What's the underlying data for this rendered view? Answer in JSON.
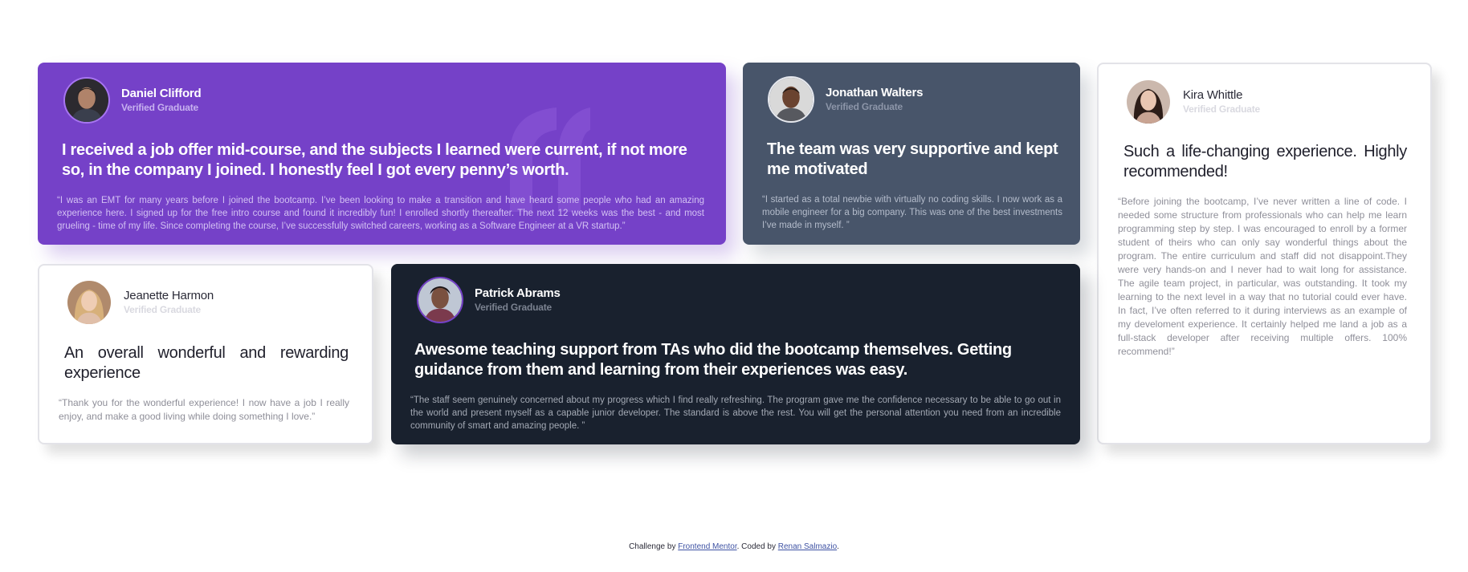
{
  "testimonials": [
    {
      "name": "Daniel Clifford",
      "status": "Verified Graduate",
      "headline": "I received a job offer mid-course, and the subjects I learned were current, if not more so, in the company I joined. I honestly feel I got every penny’s worth.",
      "body": "“I was an EMT for many years before I joined the bootcamp. I’ve been looking to make a transition and have heard some people who had an amazing experience here. I signed up for the free intro course and found it incredibly fun! I enrolled shortly thereafter. The next 12 weeks was the best - and most grueling - time of my life. Since completing the course, I’ve successfully switched careers, working as a Software Engineer at a VR startup.”",
      "background": "#7541c8"
    },
    {
      "name": "Jonathan Walters",
      "status": "Verified Graduate",
      "headline": "The team was very supportive and kept me motivated",
      "body": "“I started as a total newbie with virtually no coding skills. I now work as a mobile engineer for a big company. This was one of the best investments I’ve made in myself. ”",
      "background": "#48556a"
    },
    {
      "name": "Kira Whittle",
      "status": "Verified Graduate",
      "headline": "Such a life-changing experience. Highly recommended!",
      "body": "“Before joining the bootcamp, I’ve never written a line of code. I needed some structure from professionals who can help me learn programming step by step. I was encouraged to enroll by a former student of theirs who can only say wonderful things about the program. The entire curriculum and staff did not disappoint.They were very hands-on and I never had to wait long for assistance. The agile team project, in particular, was outstanding. It took my learning to the next level in a way that no tutorial could ever have. In fact, I’ve often referred to it during interviews as an example of my develoment experience. It certainly helped me land a job as a full-stack developer after receiving multiple offers. 100% recommend!”",
      "background": "#ffffff"
    },
    {
      "name": "Jeanette Harmon",
      "status": "Verified Graduate",
      "headline": "An overall wonderful and rewarding experience",
      "body": "“Thank you for the wonderful experience! I now have a job I really enjoy, and make a good living while doing something I love.”",
      "background": "#ffffff"
    },
    {
      "name": "Patrick Abrams",
      "status": "Verified Graduate",
      "headline": "Awesome teaching support from TAs who did the bootcamp themselves. Getting guidance from them and learning from their experiences was easy.",
      "body": "“The staff seem genuinely concerned about my progress which I find really refreshing. The program gave me the confidence necessary to be able to go out in the world and present myself as a capable junior developer. The standard is above the rest. You will get the personal attention you need from an incredible community of smart and amazing people. ”",
      "background": "#19212e"
    }
  ],
  "attribution": {
    "prefix": "Challenge by ",
    "challenge_link": "Frontend Mentor",
    "middle": ". Coded by ",
    "author_link": "Renan Salmazio",
    "suffix": "."
  },
  "icons": [
    "quote-icon",
    "avatar-photo"
  ]
}
